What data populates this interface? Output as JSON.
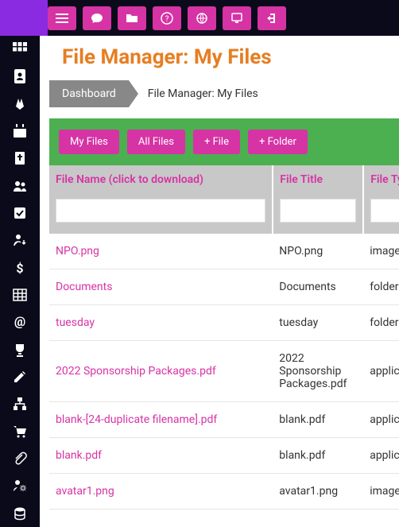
{
  "title": "File Manager: My Files",
  "breadcrumb": {
    "dashboard": "Dashboard",
    "current": "File Manager: My Files"
  },
  "buttons": {
    "myfiles": "My Files",
    "allfiles": "All Files",
    "addfile": "+ File",
    "addfolder": "+ Folder"
  },
  "headers": {
    "name": "File Name (click to download)",
    "title": "File Title",
    "type": "File Type"
  },
  "rows": [
    {
      "name": "NPO.png",
      "title": "NPO.png",
      "type": "image/png"
    },
    {
      "name": "Documents",
      "title": "Documents",
      "type": "folder"
    },
    {
      "name": "tuesday",
      "title": "tuesday",
      "type": "folder"
    },
    {
      "name": "2022 Sponsorship Packages.pdf",
      "title": "2022 Sponsorship Packages.pdf",
      "type": "application/p"
    },
    {
      "name": "blank-[24-duplicate filename].pdf",
      "title": "blank.pdf",
      "type": "application/p"
    },
    {
      "name": "blank.pdf",
      "title": "blank.pdf",
      "type": "application/p"
    },
    {
      "name": "avatar1.png",
      "title": "avatar1.png",
      "type": "image/png"
    }
  ]
}
